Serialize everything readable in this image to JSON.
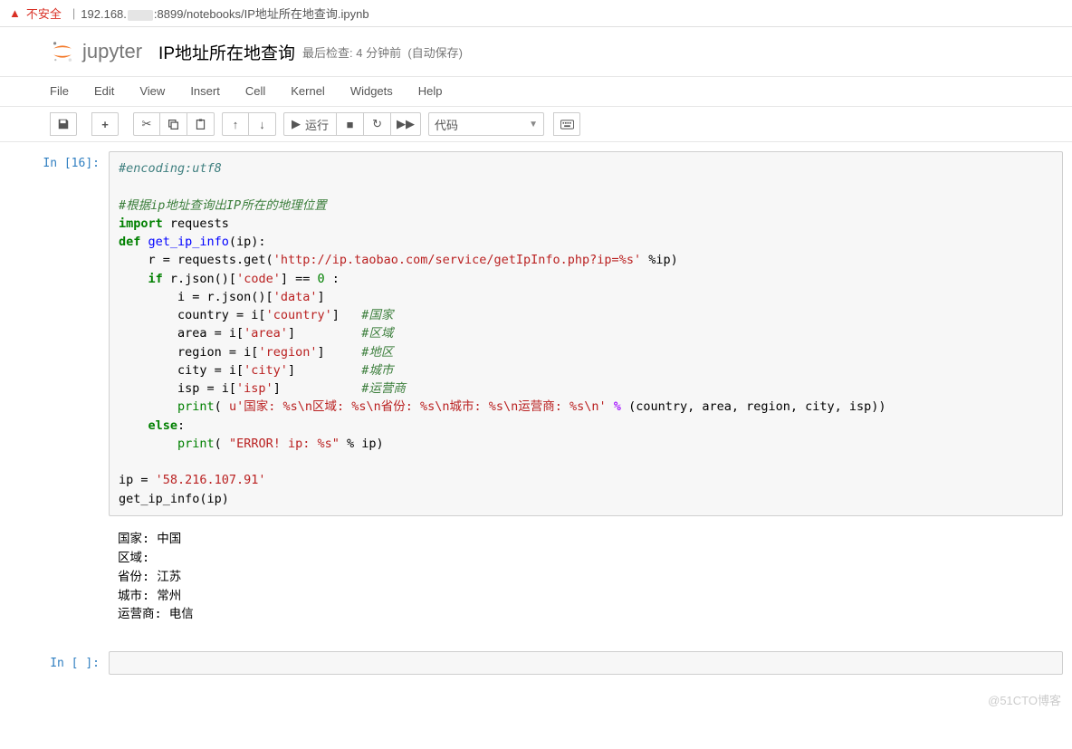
{
  "browser": {
    "not_secure": "不安全",
    "url_prefix": "192.168.",
    "url_suffix": ":8899/notebooks/IP地址所在地查询.ipynb"
  },
  "header": {
    "logo_text": "jupyter",
    "notebook_name": "IP地址所在地查询",
    "checkpoint": "最后检查: 4 分钟前",
    "autosave": "(自动保存)"
  },
  "menu": {
    "file": "File",
    "edit": "Edit",
    "view": "View",
    "insert": "Insert",
    "cell": "Cell",
    "kernel": "Kernel",
    "widgets": "Widgets",
    "help": "Help"
  },
  "toolbar": {
    "run_label": "运行",
    "celltype_value": "代码"
  },
  "cells": {
    "in16_prompt": "In [16]:",
    "in_empty_prompt": "In [ ]:",
    "code": {
      "l01_comment": "#encoding:utf8",
      "l03_comment": "#根据ip地址查询出IP所在的地理位置",
      "l04_import": "import",
      "l04_requests": " requests",
      "l05_def": "def ",
      "l05_fn": "get_ip_info",
      "l05_sig": "(ip):",
      "l06": "    r = requests.get(",
      "l06_s": "'http://ip.taobao.com/service/getIpInfo.php?ip=%s'",
      "l06_b": " %ip)",
      "l07a": "    ",
      "l07_if": "if",
      "l07b": " r.json()[",
      "l07_s": "'code'",
      "l07c": "] == ",
      "l07_m": "0",
      "l07d": " :",
      "l08": "        i = r.json()[",
      "l08_s": "'data'",
      "l08b": "]",
      "l09": "        country = i[",
      "l09_s": "'country'",
      "l09b": "]   ",
      "l09_c": "#国家",
      "l10": "        area = i[",
      "l10_s": "'area'",
      "l10b": "]         ",
      "l10_c": "#区域",
      "l11": "        region = i[",
      "l11_s": "'region'",
      "l11b": "]     ",
      "l11_c": "#地区",
      "l12": "        city = i[",
      "l12_s": "'city'",
      "l12b": "]         ",
      "l12_c": "#城市",
      "l13": "        isp = i[",
      "l13_s": "'isp'",
      "l13b": "]           ",
      "l13_c": "#运营商",
      "l14a": "        ",
      "l14_print": "print",
      "l14b": "( ",
      "l14_s": "u'国家: %s\\n区域: %s\\n省份: %s\\n城市: %s\\n运营商: %s\\n'",
      "l14c": " ",
      "l14_pct": "%",
      "l14d": " (country, area, region, city, isp))",
      "l15a": "    ",
      "l15_else": "else",
      "l15b": ":",
      "l16a": "        ",
      "l16_print": "print",
      "l16b": "( ",
      "l16_s": "\"ERROR! ip: %s\"",
      "l16c": " % ip)",
      "l18a": "ip = ",
      "l18_s": "'58.216.107.91'",
      "l19": "get_ip_info(ip)"
    },
    "output": "国家: 中国\n区域:\n省份: 江苏\n城市: 常州\n运营商: 电信"
  },
  "watermark": "@51CTO博客"
}
